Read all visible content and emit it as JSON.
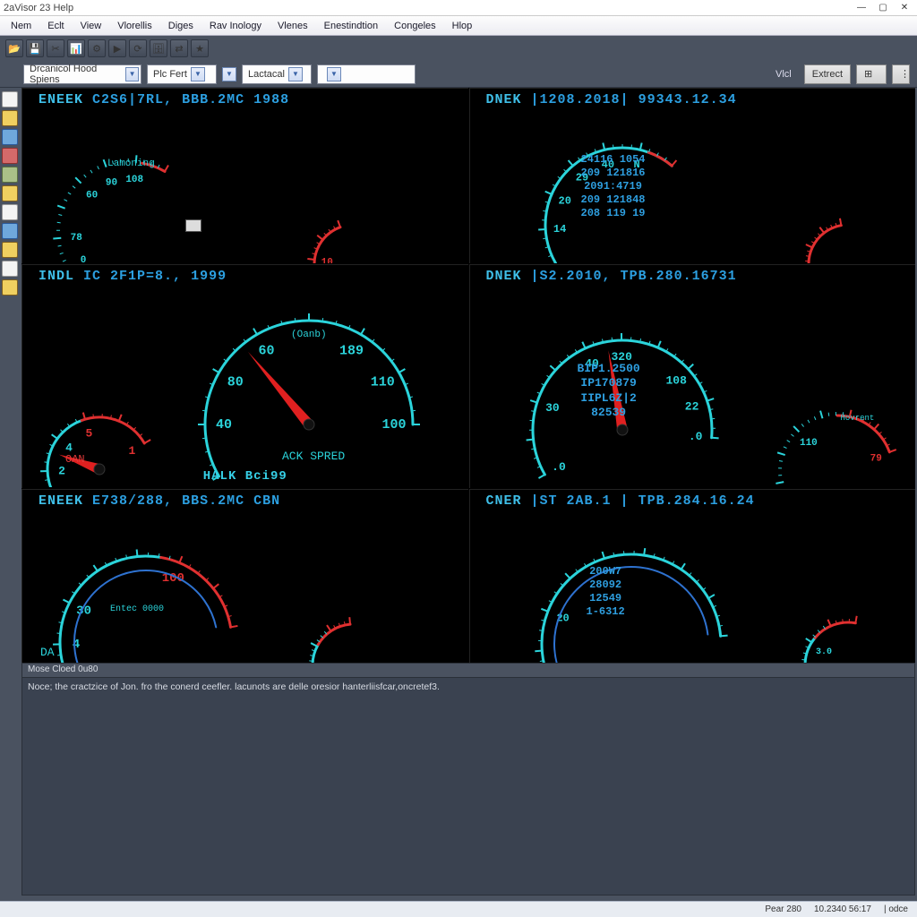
{
  "title": "2aVisor 23 Help",
  "menu": [
    "Nem",
    "Eclt",
    "View",
    "Vlorellis",
    "Diges",
    "Rav Inology",
    "Vlenes",
    "Enestindtion",
    "Congeles",
    "Hlop"
  ],
  "combos": {
    "c1": "Drcanicol Hood Spiens",
    "c2": "Plc Fert",
    "c3": "Lactacal",
    "c4": ""
  },
  "rbuttons": {
    "view": "Vlcl",
    "ext": "Extrect"
  },
  "panels": {
    "p1": {
      "a": "ENEEK",
      "b": "C2S6|7RL,",
      "c": "BBB.2MC  1988"
    },
    "p2": {
      "a": "DNEK",
      "b": "|1208.2018|",
      "c": "99343.12.34"
    },
    "p3": {
      "a": "INDL",
      "b": "IC  2F1P=8.,",
      "c": "1999"
    },
    "p4": {
      "a": "DNEK",
      "b": "|S2.2010,",
      "c": "TPB.280.16731"
    },
    "p5": {
      "a": "ENEEK",
      "b": "E738/288,",
      "c": "BBS.2MC  CBN"
    },
    "p6": {
      "a": "CNER",
      "b": "|ST 2AB.1 |",
      "c": "TPB.284.16.24"
    }
  },
  "labels": {
    "lamoning": "Lamoning",
    "ackspred": "ACK SPRED",
    "halk": "HALK Bci99",
    "oan": "OAN",
    "entec": "Entec 0000",
    "oanb": "(Oanb)",
    "hovrent": "Hovrent",
    "da": "DA"
  },
  "digits": {
    "p2": [
      "24116 1054",
      "209 121816",
      "2091:4719",
      "209 121848",
      "208 119 19"
    ],
    "p4": [
      "BIP1.2500",
      "IP170879",
      "IIPL6Z|2",
      "82539"
    ],
    "p6": [
      "200W7",
      "28092",
      "12549",
      "1-6312"
    ]
  },
  "console": {
    "head": "Mose Cloed 0u80",
    "line": "Noce; the cractzice of Jon. fro the conerd ceefler.  lacunots are delle oresior hanterliisfcar,oncretef3."
  },
  "status": {
    "a": "Pear 280",
    "b": "10.2340 56:17",
    "c": "| odce"
  }
}
